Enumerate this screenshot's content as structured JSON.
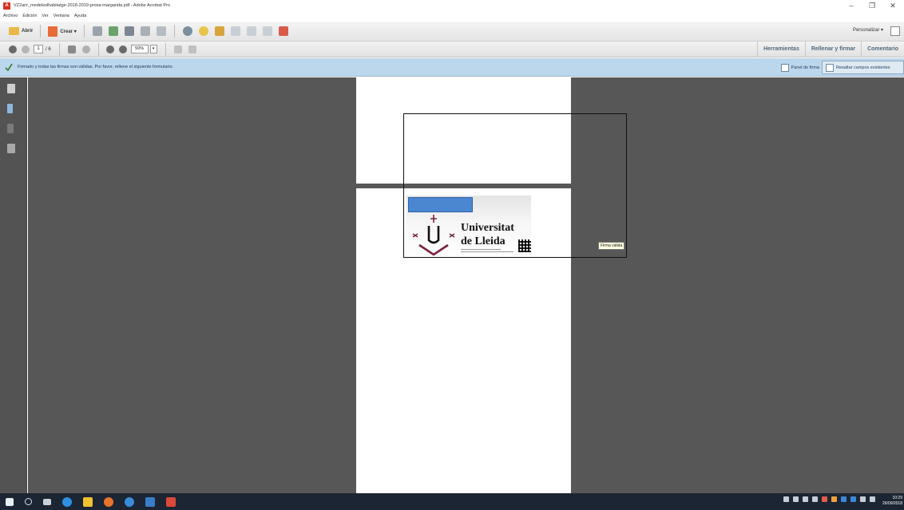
{
  "window": {
    "title": "VZ2anr_modelsolhabitatge-2018-2019-prova-margarida.pdf - Adobe Acrobat Pro",
    "min_label": "–",
    "max_label": "❐",
    "close_label": "✕"
  },
  "menu": [
    "Archivo",
    "Edición",
    "Ver",
    "Ventana",
    "Ayuda"
  ],
  "toolbar": {
    "open_label": "Abrir",
    "create_label": "Crear ▾",
    "customize_label": "Personalizar ▾"
  },
  "nav": {
    "current_page": "1",
    "total_pages": "/ 6",
    "zoom": "50%",
    "zoom_dropdown": "▾",
    "tabs": [
      "Herramientas",
      "Rellenar y firmar",
      "Comentario"
    ]
  },
  "message": {
    "text": "Firmado y todas las firmas son válidas. Por favor, rellene el siguiente formulario.",
    "panel_button": "Panel de firma",
    "highlight_button": "Resaltar campos existentes"
  },
  "document": {
    "university_line1": "Universitat",
    "university_line2": "de Lleida",
    "tooltip": "Firma válida"
  },
  "taskbar": {
    "time": "10:29",
    "date": "26/09/2018"
  },
  "colors": {
    "message_bar": "#bcd6ec",
    "blue_field": "#4b86d0",
    "doc_bg": "#575757",
    "taskbar": "#1b2533"
  }
}
